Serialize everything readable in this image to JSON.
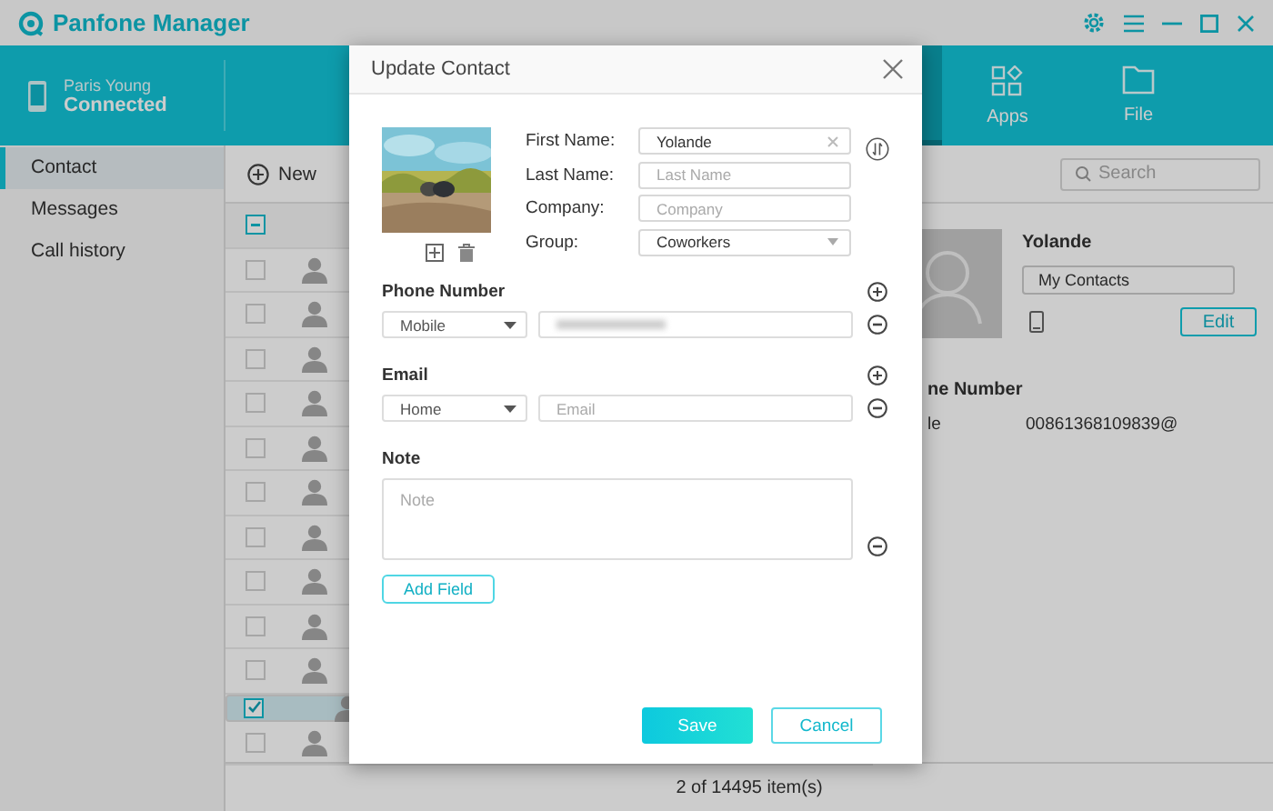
{
  "app": {
    "title": "Panfone Manager"
  },
  "device": {
    "name": "Paris Young",
    "status": "Connected"
  },
  "nav": [
    {
      "label": "Apps",
      "kind": "apps"
    },
    {
      "label": "File",
      "kind": "file"
    }
  ],
  "sidebar": {
    "items": [
      {
        "label": "Contact",
        "selected": true
      },
      {
        "label": "Messages",
        "selected": false
      },
      {
        "label": "Call history",
        "selected": false
      }
    ]
  },
  "toolbar": {
    "new": "New",
    "search": {
      "placeholder": "Search"
    }
  },
  "contacts": {
    "select_all_partial": true,
    "rows": [
      {
        "checked": false,
        "selected": false
      },
      {
        "checked": false,
        "selected": false
      },
      {
        "checked": false,
        "selected": false
      },
      {
        "checked": false,
        "selected": false
      },
      {
        "checked": false,
        "selected": false
      },
      {
        "checked": false,
        "selected": false
      },
      {
        "checked": false,
        "selected": false
      },
      {
        "checked": false,
        "selected": false
      },
      {
        "checked": false,
        "selected": false
      },
      {
        "checked": false,
        "selected": false
      },
      {
        "checked": true,
        "selected": true
      },
      {
        "checked": false,
        "selected": false
      }
    ]
  },
  "detail": {
    "name": "Yolande",
    "group": "My Contacts",
    "edit": "Edit",
    "section_label": "ne Number",
    "phone_type": "le",
    "phone": "00861368109839@"
  },
  "status_bar": "2 of 14495 item(s)",
  "dialog": {
    "title": "Update Contact",
    "fields": [
      {
        "label": "First Name:",
        "kind": "text",
        "value": "Yolande"
      },
      {
        "label": "Last Name:",
        "kind": "text",
        "placeholder": "Last Name"
      },
      {
        "label": "Company:",
        "kind": "text",
        "placeholder": "Company"
      },
      {
        "label": "Group:",
        "kind": "select",
        "value": "Coworkers"
      }
    ],
    "phone": {
      "heading": "Phone Number",
      "type": "Mobile"
    },
    "email": {
      "heading": "Email",
      "type": "Home",
      "placeholder": "Email"
    },
    "note": {
      "heading": "Note",
      "placeholder": "Note"
    },
    "add_field": "Add Field",
    "save": "Save",
    "cancel": "Cancel"
  }
}
